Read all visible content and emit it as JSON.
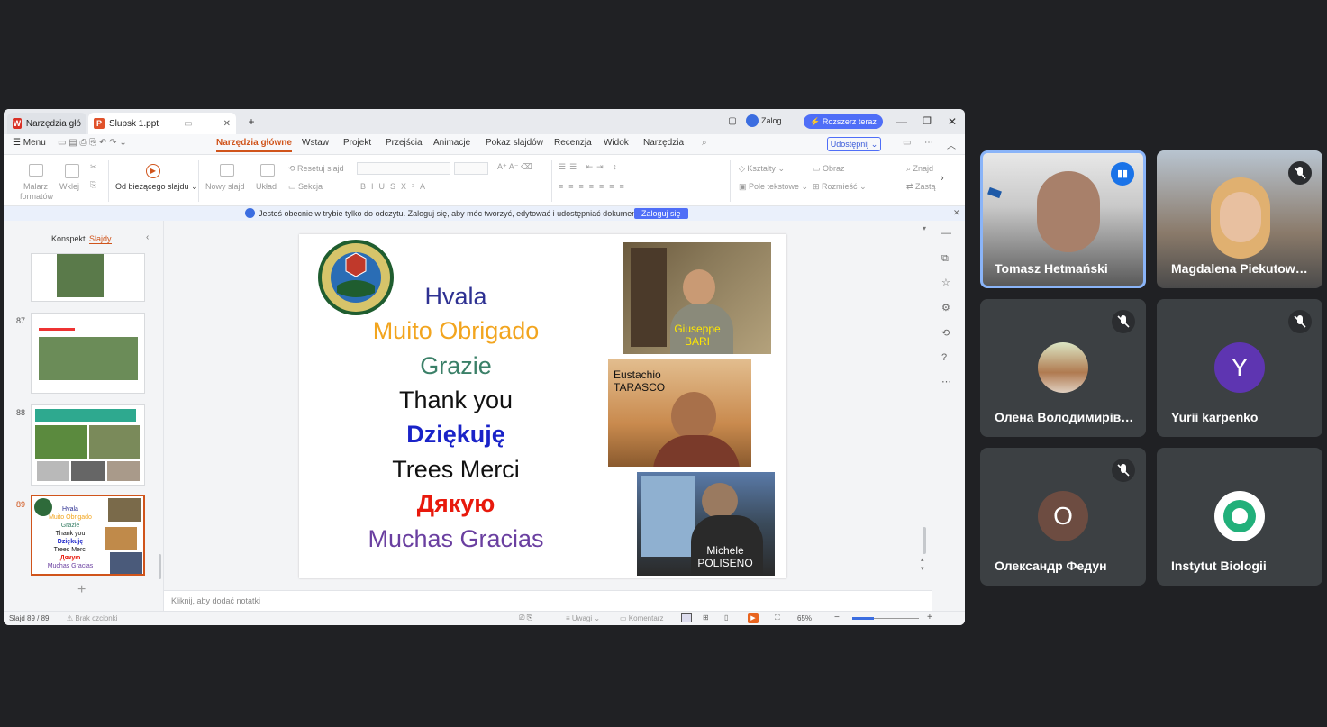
{
  "app": {
    "tabs": [
      {
        "label": "Narzędzia głó",
        "icon": "W"
      },
      {
        "label": "Slupsk 1.ppt",
        "icon": "P"
      }
    ],
    "login_short": "Zalog...",
    "upgrade": "Rozszerz teraz",
    "menu_label": "Menu",
    "ribbon_tabs": [
      "Narzędzia główne",
      "Wstaw",
      "Projekt",
      "Przejścia",
      "Animacje",
      "Pokaz slajdów",
      "Recenzja",
      "Widok",
      "Narzędzia"
    ],
    "share": "Udostępnij",
    "ribbon": {
      "format_painter_1": "Malarz",
      "format_painter_2": "formatów",
      "paste": "Wklej",
      "from_current": "Od bieżącego slajdu",
      "new_slide": "Nowy slajd",
      "layout": "Układ",
      "reset_slide": "Resetuj slajd",
      "section": "Sekcja",
      "shapes": "Kształty",
      "image": "Obraz",
      "text_box": "Pole tekstowe",
      "arrange": "Rozmieść",
      "find": "Znajd",
      "replace": "Zastą"
    },
    "info_message": "Jesteś obecnie w trybie tylko do odczytu. Zaloguj się, aby móc tworzyć, edytować i udostępniać dokumenty.",
    "login_button": "Zaloguj się",
    "panel_tabs": {
      "outline": "Konspekt",
      "slides": "Slajdy"
    },
    "thumbnails": [
      {
        "number": ""
      },
      {
        "number": "87"
      },
      {
        "number": "88"
      },
      {
        "number": "89"
      }
    ],
    "thumb89": {
      "words": [
        "Hvala",
        "Muito Obrigado",
        "Grazie",
        "Thank you",
        "Dziękuję",
        "Trees Merci",
        "Дякую",
        "Muchas Gracias"
      ]
    },
    "notes_placeholder": "Kliknij, aby dodać notatki",
    "status": {
      "slide": "Slajd 89 / 89",
      "font": "Brak czcionki",
      "comments": "Uwagi",
      "comment": "Komentarz",
      "zoom": "65%"
    }
  },
  "slide": {
    "words": [
      {
        "text": "Hvala",
        "color": "#2e3192"
      },
      {
        "text": "Muito Obrigado",
        "color": "#f2a51f"
      },
      {
        "text": "Grazie",
        "color": "#3b8068"
      },
      {
        "text": "Thank you",
        "color": "#111111"
      },
      {
        "text": "Dziękuję",
        "color": "#1a23c8"
      },
      {
        "text": "Trees Merci",
        "color": "#111111"
      },
      {
        "text": "Дякую",
        "color": "#e8190c"
      },
      {
        "text": "Muchas Gracias",
        "color": "#6a3fa0"
      }
    ],
    "captions": {
      "giuseppe_1": "Giuseppe",
      "giuseppe_2": "BARI",
      "eustachio_1": "Eustachio",
      "eustachio_2": "TARASCO",
      "michele_1": "Michele",
      "michele_2": "POLISENO"
    }
  },
  "participants": [
    {
      "name": "Tomasz Hetmański",
      "speaking": true
    },
    {
      "name": "Magdalena Piekutowska",
      "muted": true
    },
    {
      "name": "Олена Володимирівна",
      "muted": true
    },
    {
      "name": "Yurii karpenko",
      "muted": true,
      "initial": "Y",
      "color": "#5e35b1"
    },
    {
      "name": "Олександр Федун",
      "muted": true,
      "initial": "О",
      "color": "#6d4c41"
    },
    {
      "name": "Instytut Biologii"
    }
  ],
  "colors": {
    "accent": "#d0541b",
    "meet_bg": "#202124",
    "tile_bg": "#3c4043",
    "speaking_border": "#8ab4f8"
  }
}
